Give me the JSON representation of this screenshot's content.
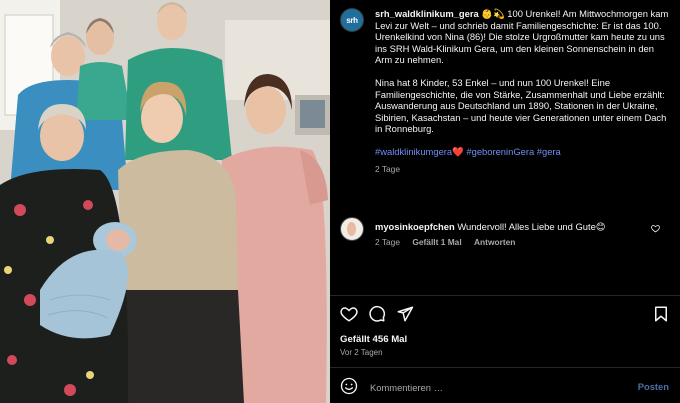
{
  "post": {
    "avatar_text": "srh",
    "username": "srh_waldklinikum_gera",
    "caption_p1": "👶💫 100 Urenkel! Am Mittwochmorgen kam Levi zur Welt – und schrieb damit Familiengeschichte: Er ist das 100. Urenkelkind von Nina (86)! Die stolze Urgroßmutter kam heute zu uns ins SRH Wald-Klinikum Gera, um den kleinen Sonnenschein in den Arm zu nehmen.",
    "caption_p2": "Nina hat 8 Kinder, 53 Enkel – und nun 100 Urenkel! Eine Familiengeschichte, die von Stärke, Zusammenhalt und Liebe erzählt: Auswanderung aus Deutschland um 1890, Stationen in der Ukraine, Sibirien, Kasachstan – und heute vier Generationen unter einem Dach in Ronneburg.",
    "hashtags": "#waldklinikumgera❤️ #geboreninGera #gera",
    "age": "2 Tage"
  },
  "comment": {
    "username": "myosinkoepfchen",
    "text": "Wundervoll! Alles Liebe und Gute😊",
    "age": "2 Tage",
    "likes": "Gefällt 1 Mal",
    "reply_label": "Antworten"
  },
  "stats": {
    "likes": "Gefällt 456 Mal",
    "posted": "Vor 2 Tagen"
  },
  "comment_input": {
    "placeholder": "Kommentieren …",
    "post_label": "Posten"
  },
  "icons": {
    "like": "heart-icon",
    "comment": "comment-icon",
    "share": "share-icon",
    "save": "bookmark-icon",
    "emoji": "smiley-icon"
  },
  "colors": {
    "background": "#000000",
    "text": "#f5f5f5",
    "muted": "#a8a8a8",
    "hashtag": "#6f8ff3",
    "post_button": "#4b6ea8"
  }
}
